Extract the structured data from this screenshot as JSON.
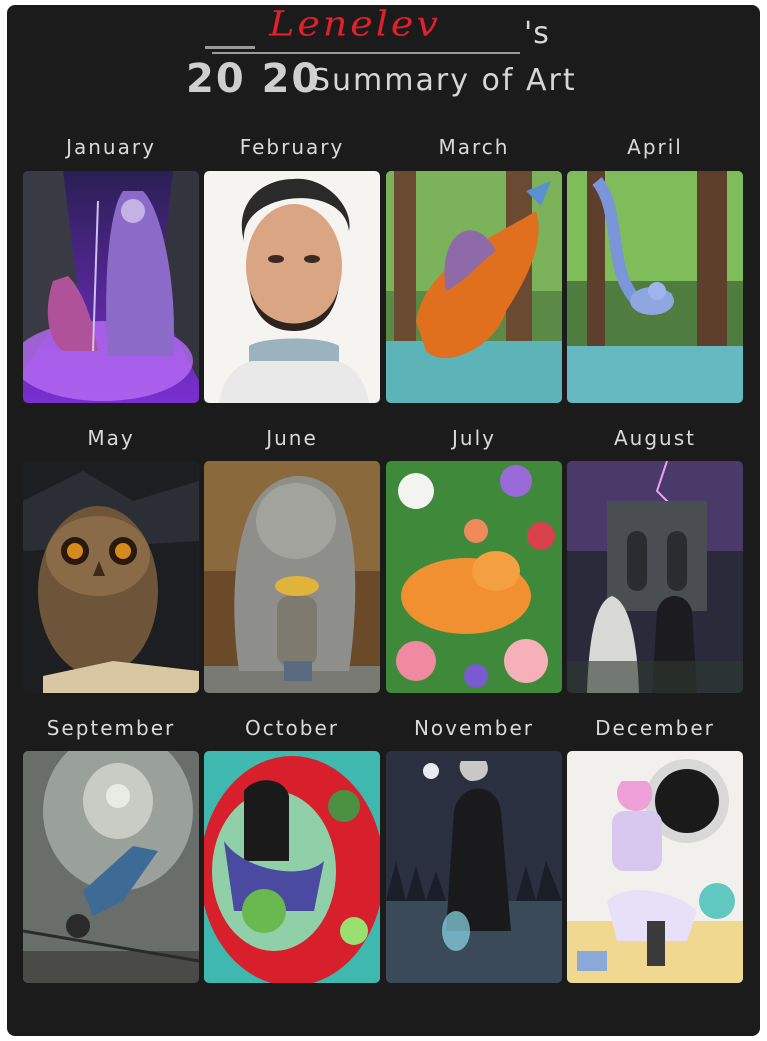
{
  "header": {
    "artist": "Lenelev",
    "suffix": "'s",
    "year": "20 20",
    "subtitle": "Summary of Art"
  },
  "months": [
    {
      "label": "January",
      "subject": "purple-ghost-witch-pool"
    },
    {
      "label": "February",
      "subject": "bearded-man-portrait"
    },
    {
      "label": "March",
      "subject": "orange-griffin-forest"
    },
    {
      "label": "April",
      "subject": "blue-mermaid-swamp"
    },
    {
      "label": "May",
      "subject": "owl-with-book"
    },
    {
      "label": "June",
      "subject": "stone-lion-and-girl"
    },
    {
      "label": "July",
      "subject": "cat-in-flowers"
    },
    {
      "label": "August",
      "subject": "ghost-and-man-ruins"
    },
    {
      "label": "September",
      "subject": "falling-man-tunnel"
    },
    {
      "label": "October",
      "subject": "girl-in-red-ship"
    },
    {
      "label": "November",
      "subject": "night-warrior-axe"
    },
    {
      "label": "December",
      "subject": "girl-in-room"
    }
  ],
  "colors": {
    "background": "#1b1b1b",
    "signature": "#e0202a",
    "text": "#d9d9d9"
  }
}
